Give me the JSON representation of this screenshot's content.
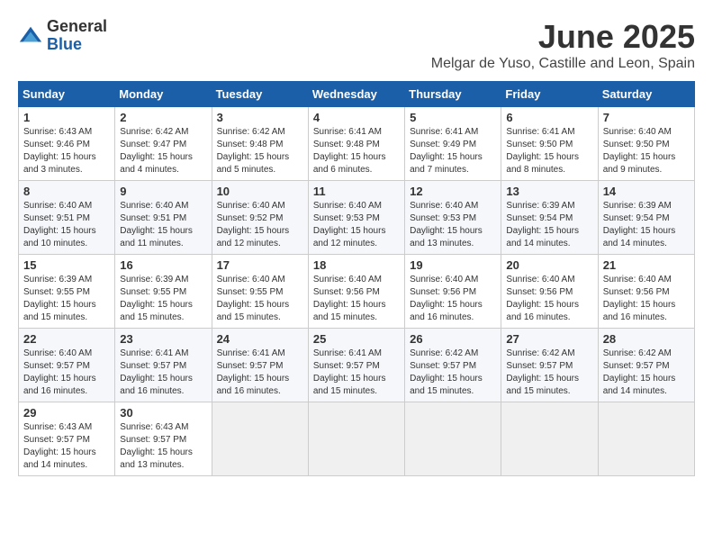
{
  "logo": {
    "general": "General",
    "blue": "Blue"
  },
  "title": "June 2025",
  "location": "Melgar de Yuso, Castille and Leon, Spain",
  "headers": [
    "Sunday",
    "Monday",
    "Tuesday",
    "Wednesday",
    "Thursday",
    "Friday",
    "Saturday"
  ],
  "weeks": [
    [
      {
        "day": "1",
        "sunrise": "Sunrise: 6:43 AM",
        "sunset": "Sunset: 9:46 PM",
        "daylight": "Daylight: 15 hours and 3 minutes."
      },
      {
        "day": "2",
        "sunrise": "Sunrise: 6:42 AM",
        "sunset": "Sunset: 9:47 PM",
        "daylight": "Daylight: 15 hours and 4 minutes."
      },
      {
        "day": "3",
        "sunrise": "Sunrise: 6:42 AM",
        "sunset": "Sunset: 9:48 PM",
        "daylight": "Daylight: 15 hours and 5 minutes."
      },
      {
        "day": "4",
        "sunrise": "Sunrise: 6:41 AM",
        "sunset": "Sunset: 9:48 PM",
        "daylight": "Daylight: 15 hours and 6 minutes."
      },
      {
        "day": "5",
        "sunrise": "Sunrise: 6:41 AM",
        "sunset": "Sunset: 9:49 PM",
        "daylight": "Daylight: 15 hours and 7 minutes."
      },
      {
        "day": "6",
        "sunrise": "Sunrise: 6:41 AM",
        "sunset": "Sunset: 9:50 PM",
        "daylight": "Daylight: 15 hours and 8 minutes."
      },
      {
        "day": "7",
        "sunrise": "Sunrise: 6:40 AM",
        "sunset": "Sunset: 9:50 PM",
        "daylight": "Daylight: 15 hours and 9 minutes."
      }
    ],
    [
      {
        "day": "8",
        "sunrise": "Sunrise: 6:40 AM",
        "sunset": "Sunset: 9:51 PM",
        "daylight": "Daylight: 15 hours and 10 minutes."
      },
      {
        "day": "9",
        "sunrise": "Sunrise: 6:40 AM",
        "sunset": "Sunset: 9:51 PM",
        "daylight": "Daylight: 15 hours and 11 minutes."
      },
      {
        "day": "10",
        "sunrise": "Sunrise: 6:40 AM",
        "sunset": "Sunset: 9:52 PM",
        "daylight": "Daylight: 15 hours and 12 minutes."
      },
      {
        "day": "11",
        "sunrise": "Sunrise: 6:40 AM",
        "sunset": "Sunset: 9:53 PM",
        "daylight": "Daylight: 15 hours and 12 minutes."
      },
      {
        "day": "12",
        "sunrise": "Sunrise: 6:40 AM",
        "sunset": "Sunset: 9:53 PM",
        "daylight": "Daylight: 15 hours and 13 minutes."
      },
      {
        "day": "13",
        "sunrise": "Sunrise: 6:39 AM",
        "sunset": "Sunset: 9:54 PM",
        "daylight": "Daylight: 15 hours and 14 minutes."
      },
      {
        "day": "14",
        "sunrise": "Sunrise: 6:39 AM",
        "sunset": "Sunset: 9:54 PM",
        "daylight": "Daylight: 15 hours and 14 minutes."
      }
    ],
    [
      {
        "day": "15",
        "sunrise": "Sunrise: 6:39 AM",
        "sunset": "Sunset: 9:55 PM",
        "daylight": "Daylight: 15 hours and 15 minutes."
      },
      {
        "day": "16",
        "sunrise": "Sunrise: 6:39 AM",
        "sunset": "Sunset: 9:55 PM",
        "daylight": "Daylight: 15 hours and 15 minutes."
      },
      {
        "day": "17",
        "sunrise": "Sunrise: 6:40 AM",
        "sunset": "Sunset: 9:55 PM",
        "daylight": "Daylight: 15 hours and 15 minutes."
      },
      {
        "day": "18",
        "sunrise": "Sunrise: 6:40 AM",
        "sunset": "Sunset: 9:56 PM",
        "daylight": "Daylight: 15 hours and 15 minutes."
      },
      {
        "day": "19",
        "sunrise": "Sunrise: 6:40 AM",
        "sunset": "Sunset: 9:56 PM",
        "daylight": "Daylight: 15 hours and 16 minutes."
      },
      {
        "day": "20",
        "sunrise": "Sunrise: 6:40 AM",
        "sunset": "Sunset: 9:56 PM",
        "daylight": "Daylight: 15 hours and 16 minutes."
      },
      {
        "day": "21",
        "sunrise": "Sunrise: 6:40 AM",
        "sunset": "Sunset: 9:56 PM",
        "daylight": "Daylight: 15 hours and 16 minutes."
      }
    ],
    [
      {
        "day": "22",
        "sunrise": "Sunrise: 6:40 AM",
        "sunset": "Sunset: 9:57 PM",
        "daylight": "Daylight: 15 hours and 16 minutes."
      },
      {
        "day": "23",
        "sunrise": "Sunrise: 6:41 AM",
        "sunset": "Sunset: 9:57 PM",
        "daylight": "Daylight: 15 hours and 16 minutes."
      },
      {
        "day": "24",
        "sunrise": "Sunrise: 6:41 AM",
        "sunset": "Sunset: 9:57 PM",
        "daylight": "Daylight: 15 hours and 16 minutes."
      },
      {
        "day": "25",
        "sunrise": "Sunrise: 6:41 AM",
        "sunset": "Sunset: 9:57 PM",
        "daylight": "Daylight: 15 hours and 15 minutes."
      },
      {
        "day": "26",
        "sunrise": "Sunrise: 6:42 AM",
        "sunset": "Sunset: 9:57 PM",
        "daylight": "Daylight: 15 hours and 15 minutes."
      },
      {
        "day": "27",
        "sunrise": "Sunrise: 6:42 AM",
        "sunset": "Sunset: 9:57 PM",
        "daylight": "Daylight: 15 hours and 15 minutes."
      },
      {
        "day": "28",
        "sunrise": "Sunrise: 6:42 AM",
        "sunset": "Sunset: 9:57 PM",
        "daylight": "Daylight: 15 hours and 14 minutes."
      }
    ],
    [
      {
        "day": "29",
        "sunrise": "Sunrise: 6:43 AM",
        "sunset": "Sunset: 9:57 PM",
        "daylight": "Daylight: 15 hours and 14 minutes."
      },
      {
        "day": "30",
        "sunrise": "Sunrise: 6:43 AM",
        "sunset": "Sunset: 9:57 PM",
        "daylight": "Daylight: 15 hours and 13 minutes."
      },
      null,
      null,
      null,
      null,
      null
    ]
  ]
}
